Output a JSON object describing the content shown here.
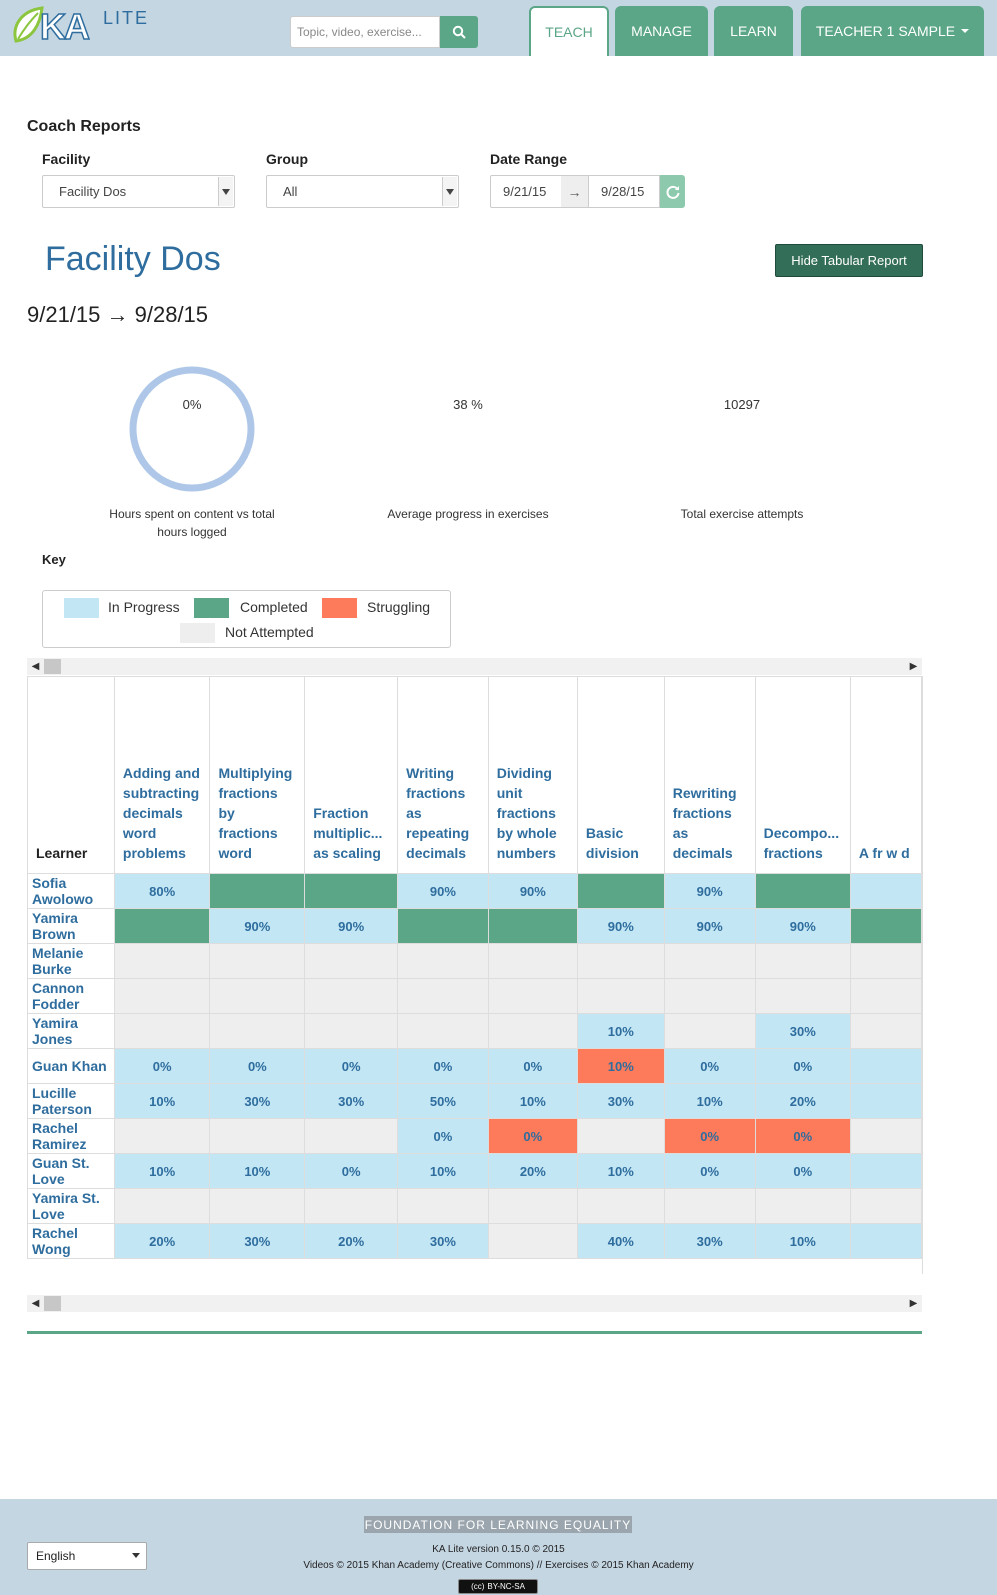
{
  "app": {
    "logo": {
      "ka": "KA",
      "lite": "LITE"
    },
    "search": {
      "placeholder": "Topic, video, exercise..."
    },
    "nav": {
      "teach": "TEACH",
      "manage": "MANAGE",
      "learn": "LEARN",
      "user": "TEACHER 1 SAMPLE"
    }
  },
  "page": {
    "title": "Coach Reports",
    "filters": {
      "facility_label": "Facility",
      "facility_value": "Facility Dos",
      "group_label": "Group",
      "group_value": "All",
      "date_label": "Date Range",
      "date_from": "9/21/15",
      "date_to": "9/28/15",
      "date_sep": "→"
    },
    "facility_heading": "Facility Dos",
    "hide_button": "Hide Tabular Report",
    "date_range_heading": "9/21/15 → 9/28/15"
  },
  "stats": [
    {
      "value": "0%",
      "label": "Hours spent on content vs total hours logged",
      "fraction": 0
    },
    {
      "value": "38 %",
      "label": "Average progress in exercises"
    },
    {
      "value": "10297",
      "label": "Total exercise attempts"
    }
  ],
  "key": {
    "title": "Key",
    "in_progress": "In Progress",
    "completed": "Completed",
    "struggling": "Struggling",
    "not_attempted": "Not Attempted",
    "colors": {
      "in_progress": "#c3e6f4",
      "completed": "#5aa687",
      "struggling": "#fd7a5a",
      "not_attempted": "#eeeeee"
    }
  },
  "table": {
    "learner_header": "Learner",
    "columns": [
      "Adding and subtracting decimals word problems",
      "Multiplying fractions by fractions word problems",
      "Fraction multiplic... as scaling",
      "Writing fractions as repeating decimals",
      "Dividing unit fractions by whole numbers",
      "Basic division",
      "Rewriting fractions as decimals",
      "Decompo... fractions",
      "A fr w d"
    ],
    "rows": [
      {
        "name": "Sofia Awolowo",
        "cells": [
          {
            "s": "in",
            "v": "80%"
          },
          {
            "s": "done",
            "v": ""
          },
          {
            "s": "done",
            "v": ""
          },
          {
            "s": "in",
            "v": "90%"
          },
          {
            "s": "in",
            "v": "90%"
          },
          {
            "s": "done",
            "v": ""
          },
          {
            "s": "in",
            "v": "90%"
          },
          {
            "s": "done",
            "v": ""
          },
          {
            "s": "in",
            "v": ""
          }
        ]
      },
      {
        "name": "Yamira Brown",
        "cells": [
          {
            "s": "done",
            "v": ""
          },
          {
            "s": "in",
            "v": "90%"
          },
          {
            "s": "in",
            "v": "90%"
          },
          {
            "s": "done",
            "v": ""
          },
          {
            "s": "done",
            "v": ""
          },
          {
            "s": "in",
            "v": "90%"
          },
          {
            "s": "in",
            "v": "90%"
          },
          {
            "s": "in",
            "v": "90%"
          },
          {
            "s": "done",
            "v": ""
          }
        ]
      },
      {
        "name": "Melanie Burke",
        "cells": [
          {
            "s": "none",
            "v": ""
          },
          {
            "s": "none",
            "v": ""
          },
          {
            "s": "none",
            "v": ""
          },
          {
            "s": "none",
            "v": ""
          },
          {
            "s": "none",
            "v": ""
          },
          {
            "s": "none",
            "v": ""
          },
          {
            "s": "none",
            "v": ""
          },
          {
            "s": "none",
            "v": ""
          },
          {
            "s": "none",
            "v": ""
          }
        ]
      },
      {
        "name": "Cannon Fodder",
        "cells": [
          {
            "s": "none",
            "v": ""
          },
          {
            "s": "none",
            "v": ""
          },
          {
            "s": "none",
            "v": ""
          },
          {
            "s": "none",
            "v": ""
          },
          {
            "s": "none",
            "v": ""
          },
          {
            "s": "none",
            "v": ""
          },
          {
            "s": "none",
            "v": ""
          },
          {
            "s": "none",
            "v": ""
          },
          {
            "s": "none",
            "v": ""
          }
        ]
      },
      {
        "name": "Yamira Jones",
        "cells": [
          {
            "s": "none",
            "v": ""
          },
          {
            "s": "none",
            "v": ""
          },
          {
            "s": "none",
            "v": ""
          },
          {
            "s": "none",
            "v": ""
          },
          {
            "s": "none",
            "v": ""
          },
          {
            "s": "in",
            "v": "10%"
          },
          {
            "s": "none",
            "v": ""
          },
          {
            "s": "in",
            "v": "30%"
          },
          {
            "s": "none",
            "v": ""
          }
        ]
      },
      {
        "name": "Guan Khan",
        "cells": [
          {
            "s": "in",
            "v": "0%"
          },
          {
            "s": "in",
            "v": "0%"
          },
          {
            "s": "in",
            "v": "0%"
          },
          {
            "s": "in",
            "v": "0%"
          },
          {
            "s": "in",
            "v": "0%"
          },
          {
            "s": "struggle",
            "v": "10%"
          },
          {
            "s": "in",
            "v": "0%"
          },
          {
            "s": "in",
            "v": "0%"
          },
          {
            "s": "in",
            "v": ""
          }
        ]
      },
      {
        "name": "Lucille Paterson",
        "cells": [
          {
            "s": "in",
            "v": "10%"
          },
          {
            "s": "in",
            "v": "30%"
          },
          {
            "s": "in",
            "v": "30%"
          },
          {
            "s": "in",
            "v": "50%"
          },
          {
            "s": "in",
            "v": "10%"
          },
          {
            "s": "in",
            "v": "30%"
          },
          {
            "s": "in",
            "v": "10%"
          },
          {
            "s": "in",
            "v": "20%"
          },
          {
            "s": "in",
            "v": ""
          }
        ]
      },
      {
        "name": "Rachel Ramirez",
        "cells": [
          {
            "s": "none",
            "v": ""
          },
          {
            "s": "none",
            "v": ""
          },
          {
            "s": "none",
            "v": ""
          },
          {
            "s": "in",
            "v": "0%"
          },
          {
            "s": "struggle",
            "v": "0%"
          },
          {
            "s": "none",
            "v": ""
          },
          {
            "s": "struggle",
            "v": "0%"
          },
          {
            "s": "struggle",
            "v": "0%"
          },
          {
            "s": "none",
            "v": ""
          }
        ]
      },
      {
        "name": "Guan St. Love",
        "cells": [
          {
            "s": "in",
            "v": "10%"
          },
          {
            "s": "in",
            "v": "10%"
          },
          {
            "s": "in",
            "v": "0%"
          },
          {
            "s": "in",
            "v": "10%"
          },
          {
            "s": "in",
            "v": "20%"
          },
          {
            "s": "in",
            "v": "10%"
          },
          {
            "s": "in",
            "v": "0%"
          },
          {
            "s": "in",
            "v": "0%"
          },
          {
            "s": "in",
            "v": ""
          }
        ]
      },
      {
        "name": "Yamira St. Love",
        "cells": [
          {
            "s": "none",
            "v": ""
          },
          {
            "s": "none",
            "v": ""
          },
          {
            "s": "none",
            "v": ""
          },
          {
            "s": "none",
            "v": ""
          },
          {
            "s": "none",
            "v": ""
          },
          {
            "s": "none",
            "v": ""
          },
          {
            "s": "none",
            "v": ""
          },
          {
            "s": "none",
            "v": ""
          },
          {
            "s": "none",
            "v": ""
          }
        ]
      },
      {
        "name": "Rachel Wong",
        "cells": [
          {
            "s": "in",
            "v": "20%"
          },
          {
            "s": "in",
            "v": "30%"
          },
          {
            "s": "in",
            "v": "20%"
          },
          {
            "s": "in",
            "v": "30%"
          },
          {
            "s": "none",
            "v": ""
          },
          {
            "s": "in",
            "v": "40%"
          },
          {
            "s": "in",
            "v": "30%"
          },
          {
            "s": "in",
            "v": "10%"
          },
          {
            "s": "in",
            "v": ""
          }
        ]
      }
    ]
  },
  "footer": {
    "fle": "FOUNDATION FOR LEARNING EQUALITY",
    "version": "KA Lite version 0.15.0 © 2015",
    "credits": "Videos © 2015 Khan Academy (Creative Commons) // Exercises © 2015 Khan Academy",
    "language": "English",
    "license": "BY-NC-SA"
  }
}
